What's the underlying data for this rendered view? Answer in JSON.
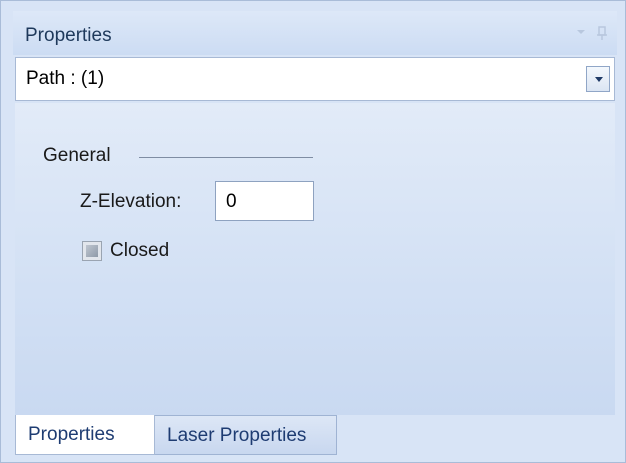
{
  "panel": {
    "title": "Properties",
    "title_icons": [
      "dropdown-arrow-icon",
      "pin-icon"
    ]
  },
  "selector": {
    "value": "Path : (1)",
    "dropdown_icon": "chevron-down-icon"
  },
  "general": {
    "group_label": "General",
    "z_elevation_label": "Z-Elevation:",
    "z_elevation_value": "0",
    "closed_label": "Closed",
    "closed_checked": false
  },
  "tabs": [
    {
      "label": "Properties",
      "active": true
    },
    {
      "label": "Laser Properties",
      "active": false
    }
  ]
}
